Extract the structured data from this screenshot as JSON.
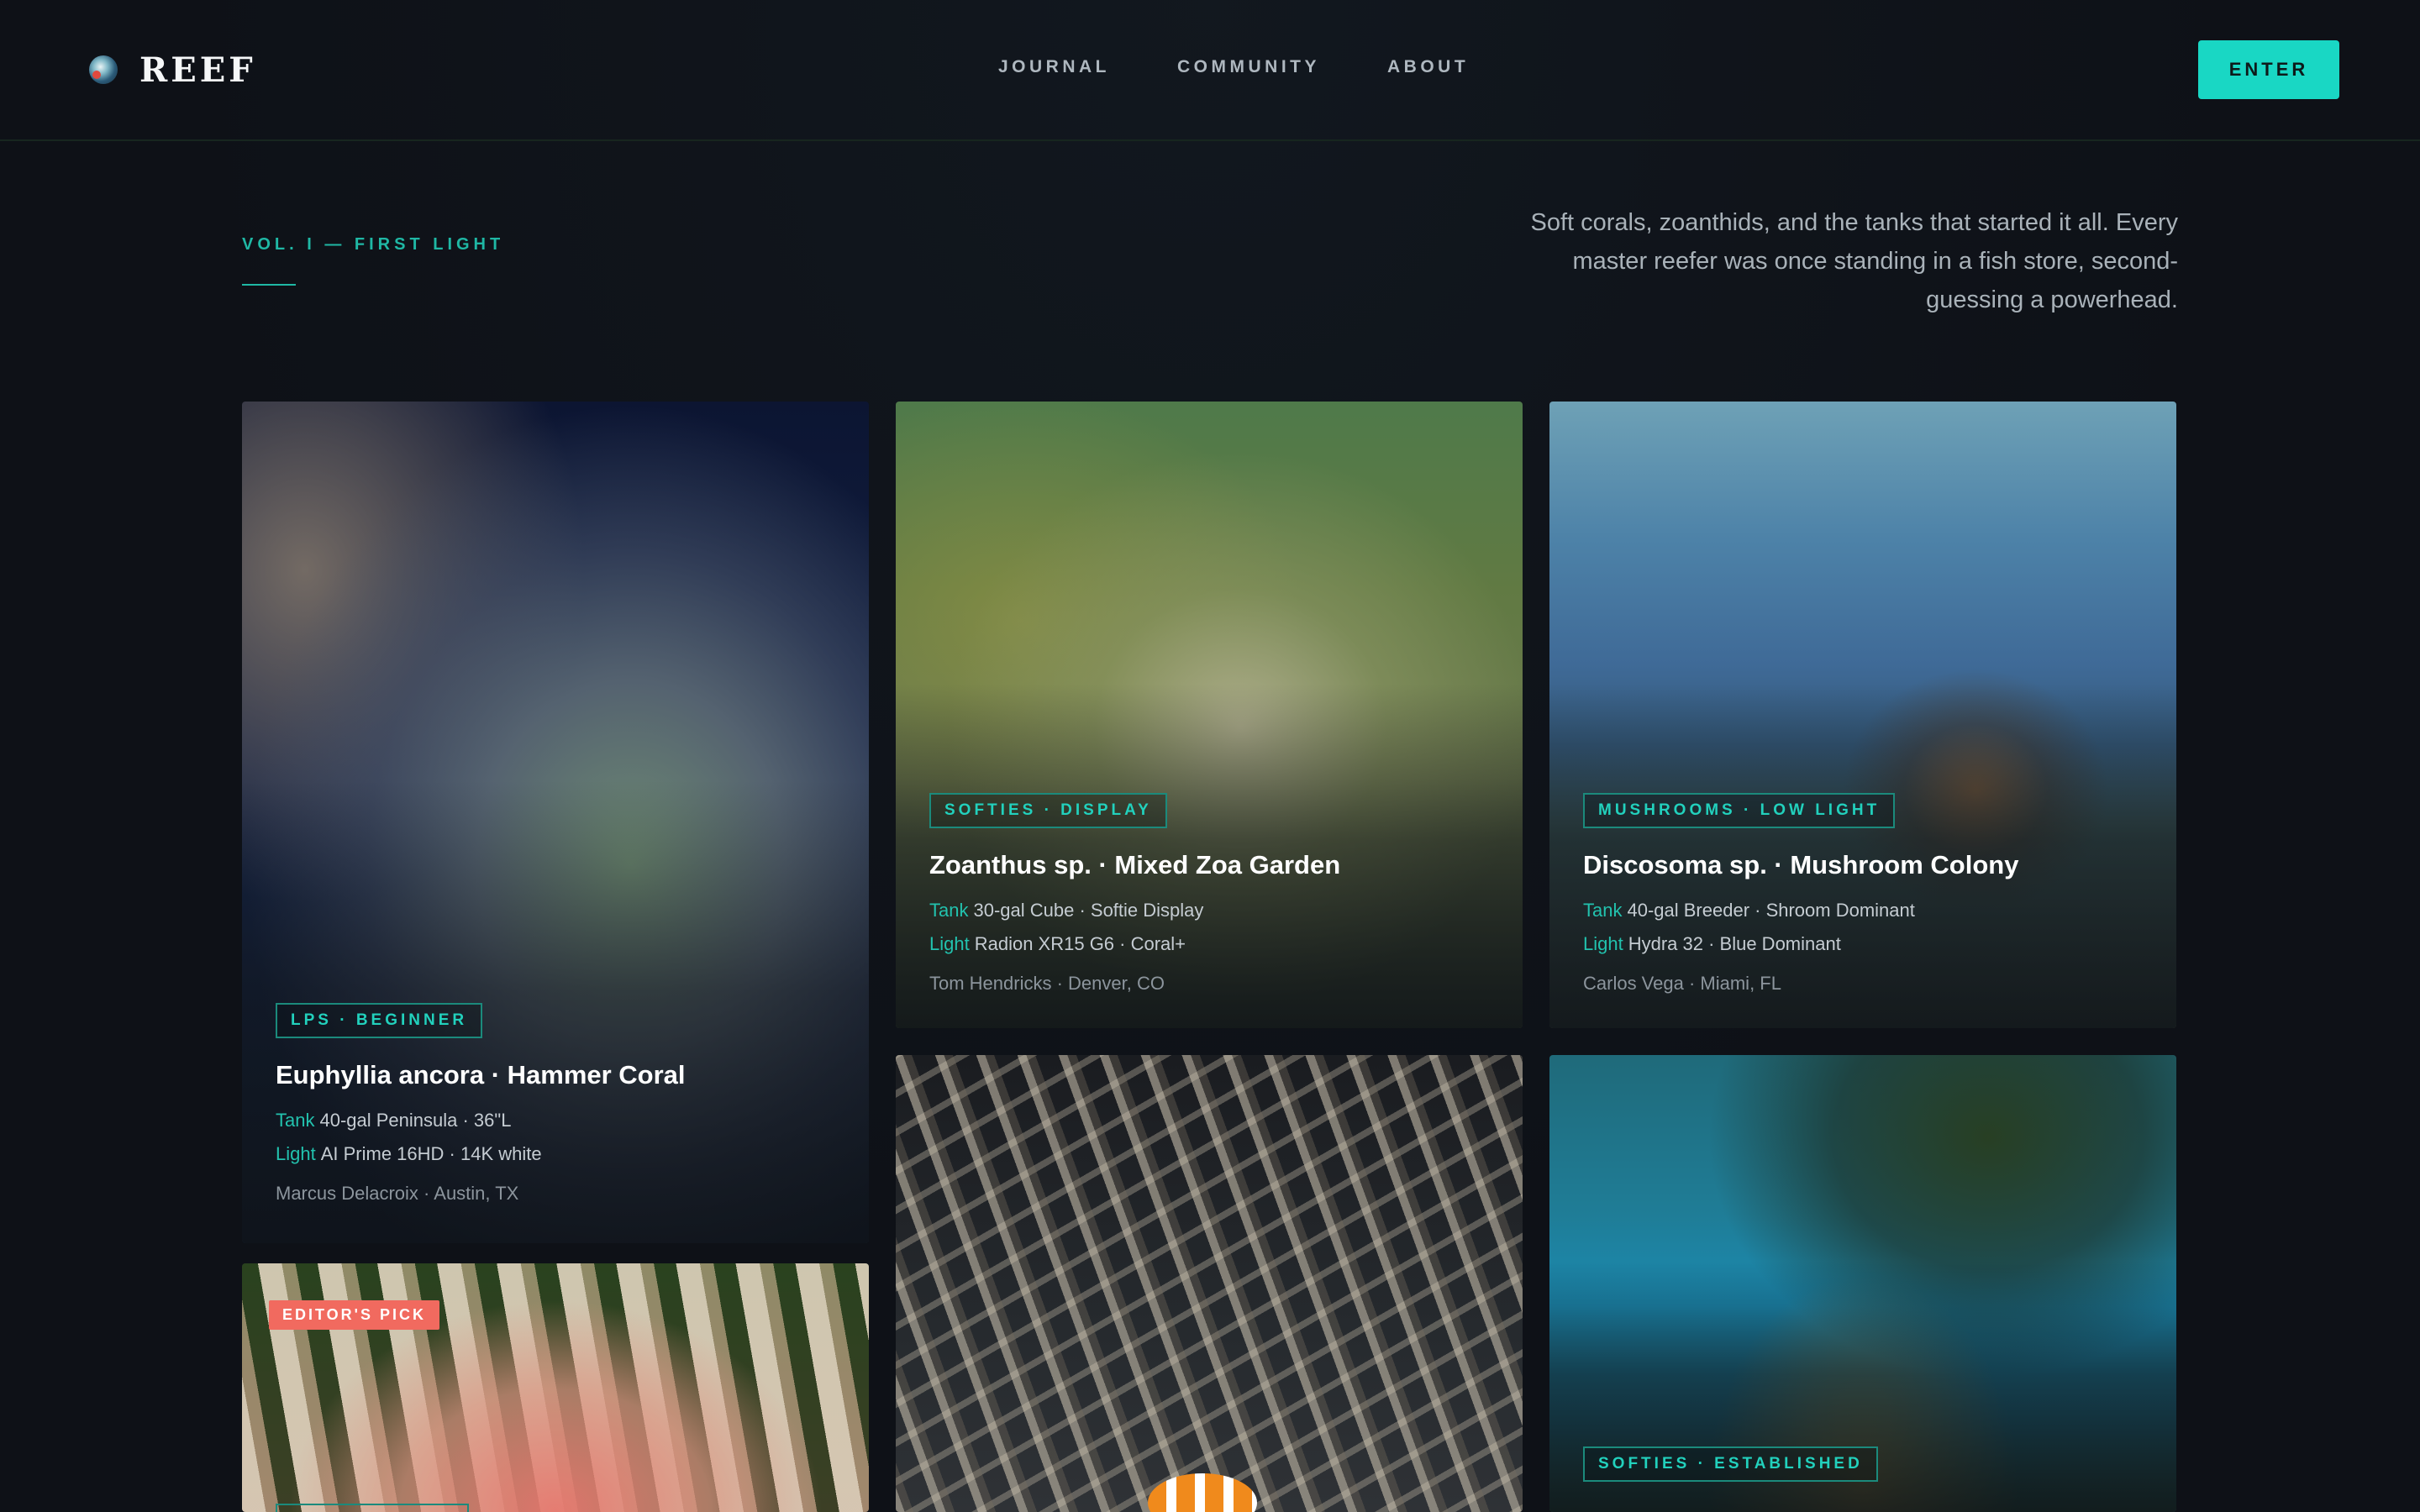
{
  "brand": {
    "name": "REEF",
    "logo_icon": "reef-globe-icon"
  },
  "nav": [
    "JOURNAL",
    "COMMUNITY",
    "ABOUT"
  ],
  "header": {
    "enter_label": "ENTER",
    "accent": "#19d7c4"
  },
  "intro": {
    "volume": "VOL. I — FIRST LIGHT",
    "text": "Soft corals, zoanthids, and the tanks that started it all. Every master reefer was once standing in a fish store, second-guessing a powerhead."
  },
  "cards": [
    {
      "tag": "LPS · BEGINNER",
      "title": "Euphyllia ancora · Hammer Coral",
      "tank_label": "Tank",
      "tank": "40-gal Peninsula · 36\"L",
      "light_label": "Light",
      "light": "AI Prime 16HD · 14K white",
      "owner": "Marcus Delacroix · Austin, TX"
    },
    {
      "tag": "SOFTIES · DISPLAY",
      "title": "Zoanthus sp. · Mixed Zoa Garden",
      "tank_label": "Tank",
      "tank": "30-gal Cube · Softie Display",
      "light_label": "Light",
      "light": "Radion XR15 G6 · Coral+",
      "owner": "Tom Hendricks · Denver, CO"
    },
    {
      "tag": "MUSHROOMS · LOW LIGHT",
      "title": "Discosoma sp. · Mushroom Colony",
      "tank_label": "Tank",
      "tank": "40-gal Breeder · Shroom Dominant",
      "light_label": "Light",
      "light": "Hydra 32 · Blue Dominant",
      "owner": "Carlos Vega · Miami, FL"
    },
    {
      "badge": "EDITOR'S PICK"
    },
    {},
    {
      "tag": "SOFTIES · ESTABLISHED"
    }
  ]
}
